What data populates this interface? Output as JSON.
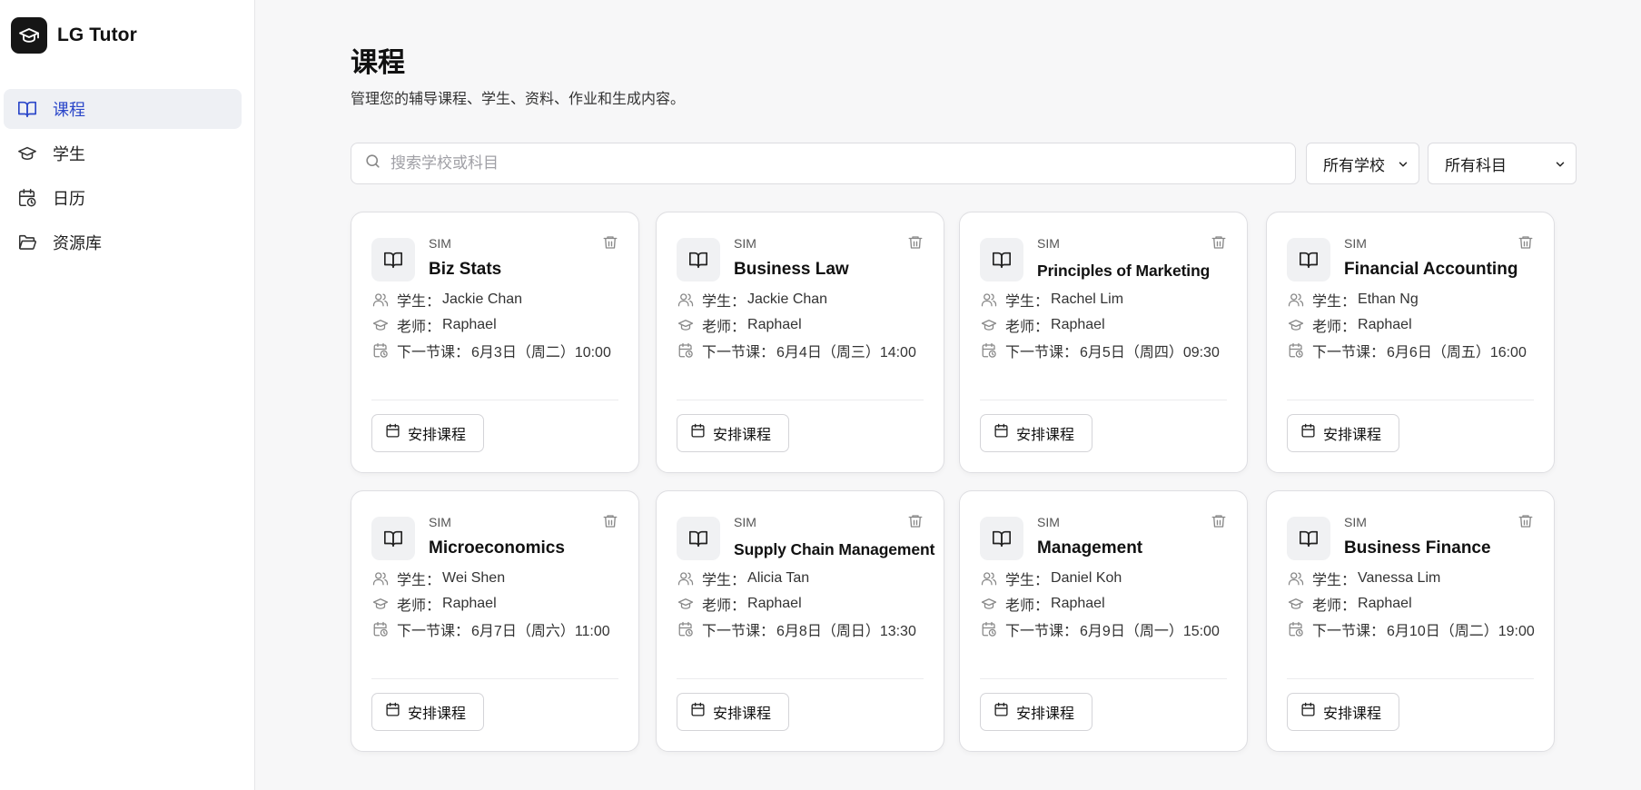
{
  "app": {
    "name": "LG Tutor"
  },
  "sidebar": {
    "items": [
      {
        "label": "课程",
        "icon": "book-open-icon",
        "active": true
      },
      {
        "label": "学生",
        "icon": "graduation-cap-icon",
        "active": false
      },
      {
        "label": "日历",
        "icon": "calendar-clock-icon",
        "active": false
      },
      {
        "label": "资源库",
        "icon": "folder-open-icon",
        "active": false
      }
    ]
  },
  "page": {
    "title": "课程",
    "subtitle": "管理您的辅导课程、学生、资料、作业和生成内容。"
  },
  "filters": {
    "search_placeholder": "搜索学校或科目",
    "school_selected": "所有学校",
    "subject_selected": "所有科目"
  },
  "labels": {
    "student": "学生：",
    "teacher": "老师：",
    "next_lesson": "下一节课：",
    "schedule_button": "安排课程"
  },
  "colors": {
    "accent": "#2b47c9",
    "logo_bg": "#161616"
  },
  "courses": [
    {
      "school": "SIM",
      "name": "Biz Stats",
      "student": "Jackie Chan",
      "teacher": "Raphael",
      "next": "6月3日（周二）10:00"
    },
    {
      "school": "SIM",
      "name": "Business Law",
      "student": "Jackie Chan",
      "teacher": "Raphael",
      "next": "6月4日（周三）14:00"
    },
    {
      "school": "SIM",
      "name": "Principles of Marketing",
      "student": "Rachel Lim",
      "teacher": "Raphael",
      "next": "6月5日（周四）09:30"
    },
    {
      "school": "SIM",
      "name": "Financial Accounting",
      "student": "Ethan Ng",
      "teacher": "Raphael",
      "next": "6月6日（周五）16:00"
    },
    {
      "school": "SIM",
      "name": "Microeconomics",
      "student": "Wei Shen",
      "teacher": "Raphael",
      "next": "6月7日（周六）11:00"
    },
    {
      "school": "SIM",
      "name": "Supply Chain Management",
      "student": "Alicia Tan",
      "teacher": "Raphael",
      "next": "6月8日（周日）13:30"
    },
    {
      "school": "SIM",
      "name": "Management",
      "student": "Daniel Koh",
      "teacher": "Raphael",
      "next": "6月9日（周一）15:00"
    },
    {
      "school": "SIM",
      "name": "Business Finance",
      "student": "Vanessa Lim",
      "teacher": "Raphael",
      "next": "6月10日（周二）19:00"
    }
  ]
}
